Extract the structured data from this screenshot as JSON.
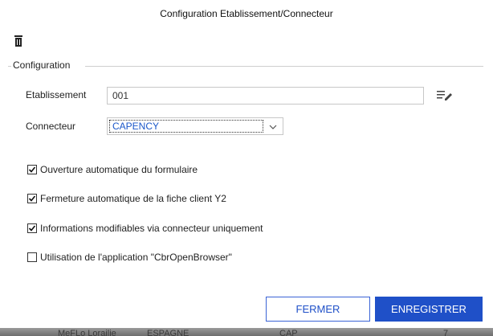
{
  "window": {
    "title": "Configuration Etablissement/Connecteur"
  },
  "toolbar": {
    "delete_icon": "trash-icon"
  },
  "group": {
    "label": "Configuration"
  },
  "fields": {
    "etablissement": {
      "label": "Etablissement",
      "value": "001",
      "edit_icon": "edit-list-icon"
    },
    "connecteur": {
      "label": "Connecteur",
      "selected": "CAPENCY"
    }
  },
  "options": [
    {
      "label": "Ouverture automatique du formulaire",
      "checked": true
    },
    {
      "label": "Fermeture automatique de la fiche client Y2",
      "checked": true
    },
    {
      "label": "Informations modifiables via connecteur uniquement",
      "checked": true
    },
    {
      "label": "Utilisation de l'application \"CbrOpenBrowser\"",
      "checked": false
    }
  ],
  "buttons": {
    "close_label": "FERMER",
    "save_label": "ENREGISTRER"
  },
  "background_peek": {
    "col1": "MeFLo Lorailie",
    "col2": "ESPAGNE",
    "col3": "CAP",
    "col4": "7"
  },
  "colors": {
    "primary": "#1f50c8",
    "selected_text": "#1a57c9"
  }
}
